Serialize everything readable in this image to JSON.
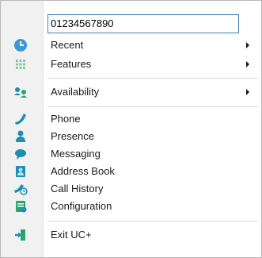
{
  "search": {
    "value": "01234567890"
  },
  "menu": {
    "items": [
      {
        "label": "Recent",
        "icon": "clock-icon",
        "submenu": true
      },
      {
        "label": "Features",
        "icon": "grid-icon",
        "submenu": true
      },
      {
        "label": "Availability",
        "icon": "availability-icon",
        "submenu": true
      },
      {
        "label": "Phone",
        "icon": "phone-icon",
        "submenu": false
      },
      {
        "label": "Presence",
        "icon": "presence-icon",
        "submenu": false
      },
      {
        "label": "Messaging",
        "icon": "messaging-icon",
        "submenu": false
      },
      {
        "label": "Address Book",
        "icon": "address-book-icon",
        "submenu": false
      },
      {
        "label": "Call History",
        "icon": "call-history-icon",
        "submenu": false
      },
      {
        "label": "Configuration",
        "icon": "configuration-icon",
        "submenu": false
      },
      {
        "label": "Exit UC+",
        "icon": "exit-icon",
        "submenu": false
      }
    ]
  },
  "colors": {
    "icon_blue": "#3a9ad9",
    "icon_green": "#2aa56e",
    "icon_teal": "#1d8fb5",
    "input_border": "#3c7fb1"
  }
}
